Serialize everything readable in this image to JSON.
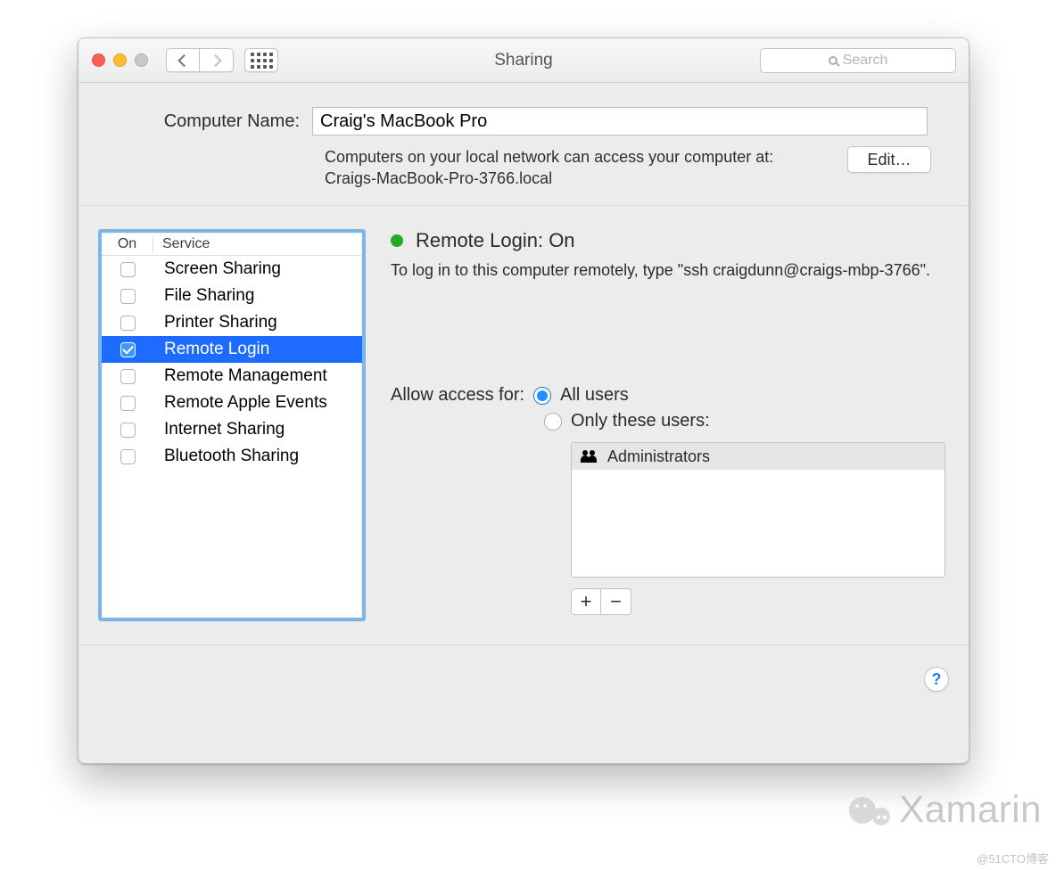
{
  "window": {
    "title": "Sharing",
    "search_placeholder": "Search"
  },
  "top": {
    "computer_name_label": "Computer Name:",
    "computer_name_value": "Craig's MacBook Pro",
    "network_hint_line1": "Computers on your local network can access your computer at:",
    "network_hint_line2": "Craigs-MacBook-Pro-3766.local",
    "edit_label": "Edit…"
  },
  "services": {
    "col_on": "On",
    "col_service": "Service",
    "items": [
      {
        "label": "Screen Sharing",
        "checked": false,
        "selected": false
      },
      {
        "label": "File Sharing",
        "checked": false,
        "selected": false
      },
      {
        "label": "Printer Sharing",
        "checked": false,
        "selected": false
      },
      {
        "label": "Remote Login",
        "checked": true,
        "selected": true
      },
      {
        "label": "Remote Management",
        "checked": false,
        "selected": false
      },
      {
        "label": "Remote Apple Events",
        "checked": false,
        "selected": false
      },
      {
        "label": "Internet Sharing",
        "checked": false,
        "selected": false
      },
      {
        "label": "Bluetooth Sharing",
        "checked": false,
        "selected": false
      }
    ]
  },
  "detail": {
    "status_title": "Remote Login: On",
    "status_color": "#1faa28",
    "description": "To log in to this computer remotely, type \"ssh craigdunn@craigs-mbp-3766\".",
    "access_label": "Allow access for:",
    "opt_all_users": "All users",
    "opt_only_these": "Only these users:",
    "access_selected": "all",
    "users": [
      {
        "label": "Administrators"
      }
    ],
    "plus": "+",
    "minus": "−"
  },
  "help_label": "?",
  "watermark_brand": "Xamarin",
  "attribution": "@51CTO博客"
}
